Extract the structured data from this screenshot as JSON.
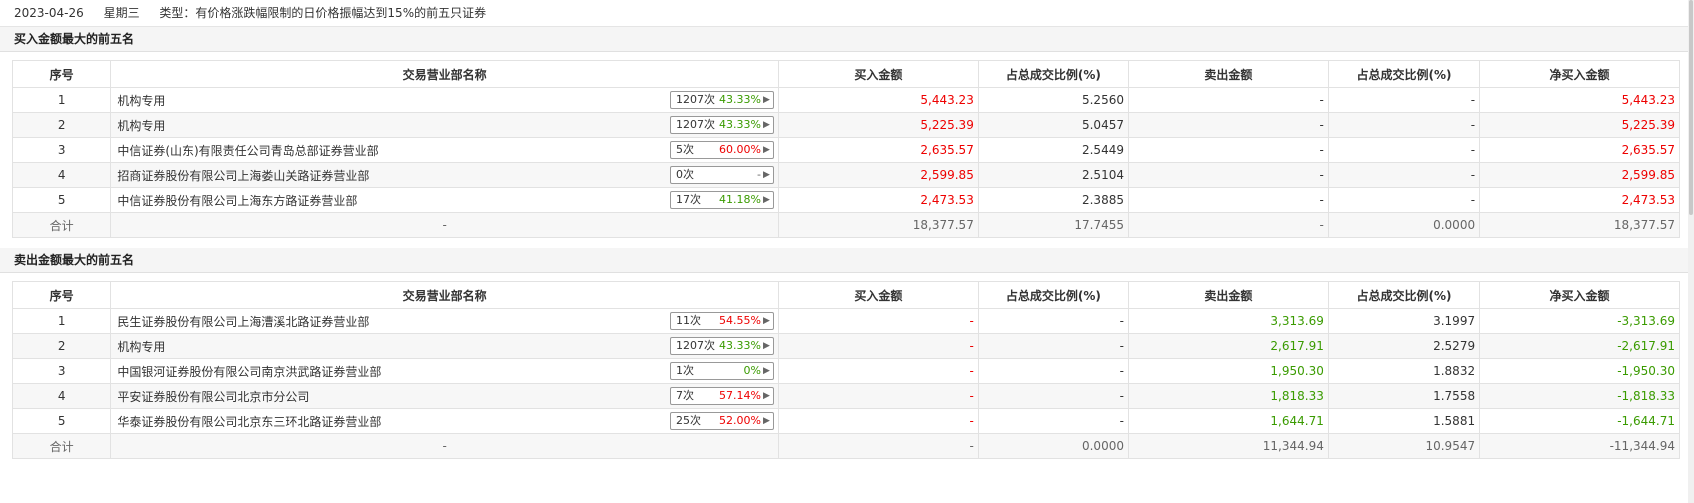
{
  "topbar": {
    "date": "2023-04-26",
    "weekday": "星期三",
    "type_text": "类型：有价格涨跌幅限制的日价格振幅达到15%的前五只证券"
  },
  "columns": {
    "seq": "序号",
    "name": "交易营业部名称",
    "buy": "买入金额",
    "buy_pct": "占总成交比例(%)",
    "sell": "卖出金额",
    "sell_pct": "占总成交比例(%)",
    "net": "净买入金额"
  },
  "buy_section": {
    "title": "买入金额最大的前五名",
    "rows": [
      {
        "seq": "1",
        "name": "机构专用",
        "times": "1207次",
        "rate": "43.33%",
        "rate_color": "green",
        "buy": "5,443.23",
        "buy_pct": "5.2560",
        "sell": "-",
        "sell_pct": "-",
        "net": "5,443.23"
      },
      {
        "seq": "2",
        "name": "机构专用",
        "times": "1207次",
        "rate": "43.33%",
        "rate_color": "green",
        "buy": "5,225.39",
        "buy_pct": "5.0457",
        "sell": "-",
        "sell_pct": "-",
        "net": "5,225.39"
      },
      {
        "seq": "3",
        "name": "中信证券(山东)有限责任公司青岛总部证券营业部",
        "times": "5次",
        "rate": "60.00%",
        "rate_color": "red",
        "buy": "2,635.57",
        "buy_pct": "2.5449",
        "sell": "-",
        "sell_pct": "-",
        "net": "2,635.57"
      },
      {
        "seq": "4",
        "name": "招商证券股份有限公司上海娄山关路证券营业部",
        "times": "0次",
        "rate": "-",
        "rate_color": "gray",
        "buy": "2,599.85",
        "buy_pct": "2.5104",
        "sell": "-",
        "sell_pct": "-",
        "net": "2,599.85"
      },
      {
        "seq": "5",
        "name": "中信证券股份有限公司上海东方路证券营业部",
        "times": "17次",
        "rate": "41.18%",
        "rate_color": "green",
        "buy": "2,473.53",
        "buy_pct": "2.3885",
        "sell": "-",
        "sell_pct": "-",
        "net": "2,473.53"
      }
    ],
    "total": {
      "label": "合计",
      "name": "-",
      "buy": "18,377.57",
      "buy_pct": "17.7455",
      "sell": "-",
      "sell_pct": "0.0000",
      "net": "18,377.57"
    }
  },
  "sell_section": {
    "title": "卖出金额最大的前五名",
    "rows": [
      {
        "seq": "1",
        "name": "民生证券股份有限公司上海漕溪北路证券营业部",
        "times": "11次",
        "rate": "54.55%",
        "rate_color": "red",
        "buy": "-",
        "buy_pct": "-",
        "sell": "3,313.69",
        "sell_pct": "3.1997",
        "net": "-3,313.69"
      },
      {
        "seq": "2",
        "name": "机构专用",
        "times": "1207次",
        "rate": "43.33%",
        "rate_color": "green",
        "buy": "-",
        "buy_pct": "-",
        "sell": "2,617.91",
        "sell_pct": "2.5279",
        "net": "-2,617.91"
      },
      {
        "seq": "3",
        "name": "中国银河证券股份有限公司南京洪武路证券营业部",
        "times": "1次",
        "rate": "0%",
        "rate_color": "green",
        "buy": "-",
        "buy_pct": "-",
        "sell": "1,950.30",
        "sell_pct": "1.8832",
        "net": "-1,950.30"
      },
      {
        "seq": "4",
        "name": "平安证券股份有限公司北京市分公司",
        "times": "7次",
        "rate": "57.14%",
        "rate_color": "red",
        "buy": "-",
        "buy_pct": "-",
        "sell": "1,818.33",
        "sell_pct": "1.7558",
        "net": "-1,818.33"
      },
      {
        "seq": "5",
        "name": "华泰证券股份有限公司北京东三环北路证券营业部",
        "times": "25次",
        "rate": "52.00%",
        "rate_color": "red",
        "buy": "-",
        "buy_pct": "-",
        "sell": "1,644.71",
        "sell_pct": "1.5881",
        "net": "-1,644.71"
      }
    ],
    "total": {
      "label": "合计",
      "name": "-",
      "buy": "-",
      "buy_pct": "0.0000",
      "sell": "11,344.94",
      "sell_pct": "10.9547",
      "net": "-11,344.94"
    }
  },
  "colors": {
    "red": "#e00000",
    "green": "#3a9b00",
    "gray": "#666666"
  }
}
